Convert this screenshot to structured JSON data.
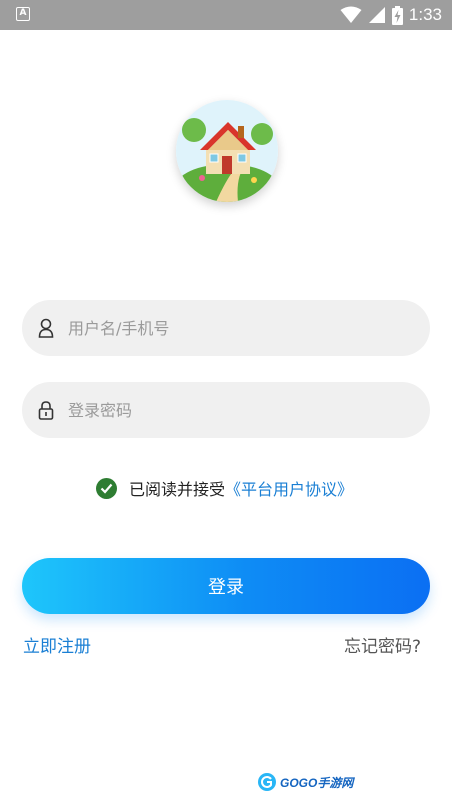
{
  "status_bar": {
    "app_icon_letter": "A",
    "time": "1:33",
    "icons": [
      "wifi-icon",
      "signal-icon",
      "battery-charging-icon"
    ]
  },
  "logo": {
    "icon": "house-logo-icon"
  },
  "username_field": {
    "value": "",
    "placeholder": "用户名/手机号",
    "icon": "user-icon"
  },
  "password_field": {
    "value": "",
    "placeholder": "登录密码",
    "icon": "lock-icon"
  },
  "agreement": {
    "checked": true,
    "text": "已阅读并接受",
    "link": "《平台用户协议》"
  },
  "login_button": {
    "label": "登录"
  },
  "register_link": {
    "label": "立即注册"
  },
  "forgot_link": {
    "label": "忘记密码?"
  },
  "watermark": {
    "text": "GOGO手游网"
  },
  "colors": {
    "accent": "#1a7fd4",
    "button_gradient_start": "#1ec6fb",
    "button_gradient_end": "#0b6ff3",
    "check_green": "#2e7d32",
    "field_bg": "#f0f0f0",
    "status_bar": "#9e9e9e"
  }
}
